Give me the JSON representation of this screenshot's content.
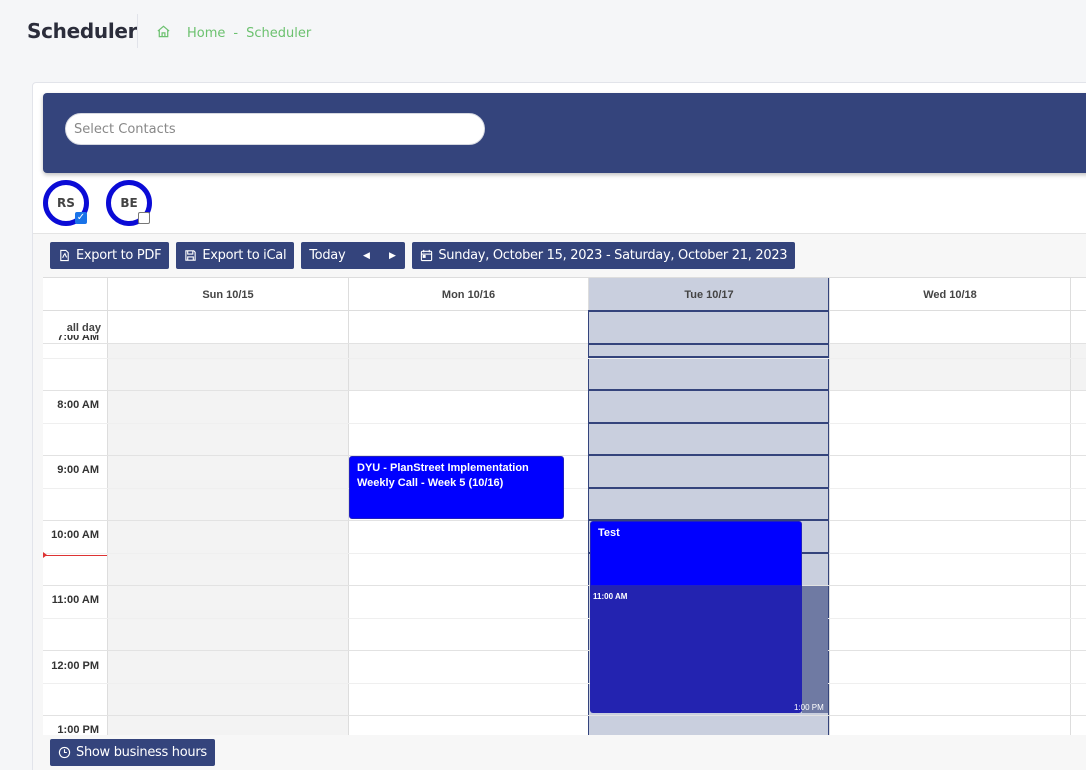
{
  "header": {
    "title": "Scheduler",
    "breadcrumb": {
      "home": "Home",
      "separator": "-",
      "current": "Scheduler",
      "home_icon": "home-icon"
    }
  },
  "contacts": {
    "placeholder": "Select Contacts",
    "avatars": [
      {
        "initials": "RS",
        "checked": true
      },
      {
        "initials": "BE",
        "checked": false
      }
    ]
  },
  "toolbar": {
    "export_pdf": "Export to PDF",
    "export_ical": "Export to iCal",
    "today": "Today",
    "prev_icon": "◀",
    "next_icon": "▶",
    "date_range": "Sunday, October 15, 2023 - Saturday, October 21, 2023"
  },
  "calendar": {
    "days": [
      "Sun 10/15",
      "Mon 10/16",
      "Tue 10/17",
      "Wed 10/18"
    ],
    "today": "Tue 10/17",
    "all_day_label": "all day",
    "times": [
      "7:00 AM",
      "8:00 AM",
      "9:00 AM",
      "10:00 AM",
      "11:00 AM",
      "12:00 PM",
      "1:00 PM"
    ],
    "events": [
      {
        "title": "DYU - PlanStreet Implementation Weekly Call - Week 5 (10/16)",
        "day": "Mon 10/16",
        "start": "9:00 AM",
        "end": "10:00 AM"
      },
      {
        "title": "Test",
        "day": "Tue 10/17",
        "start": "10:00 AM",
        "end": "1:00 PM",
        "start_label": "11:00 AM",
        "end_label": "1:00 PM"
      }
    ]
  },
  "footer": {
    "business_hours": "Show business hours"
  },
  "colors": {
    "primary": "#34447c",
    "event": "#0000ff",
    "accent_green": "#6cc16f",
    "avatar_ring": "#0b0bd6"
  }
}
